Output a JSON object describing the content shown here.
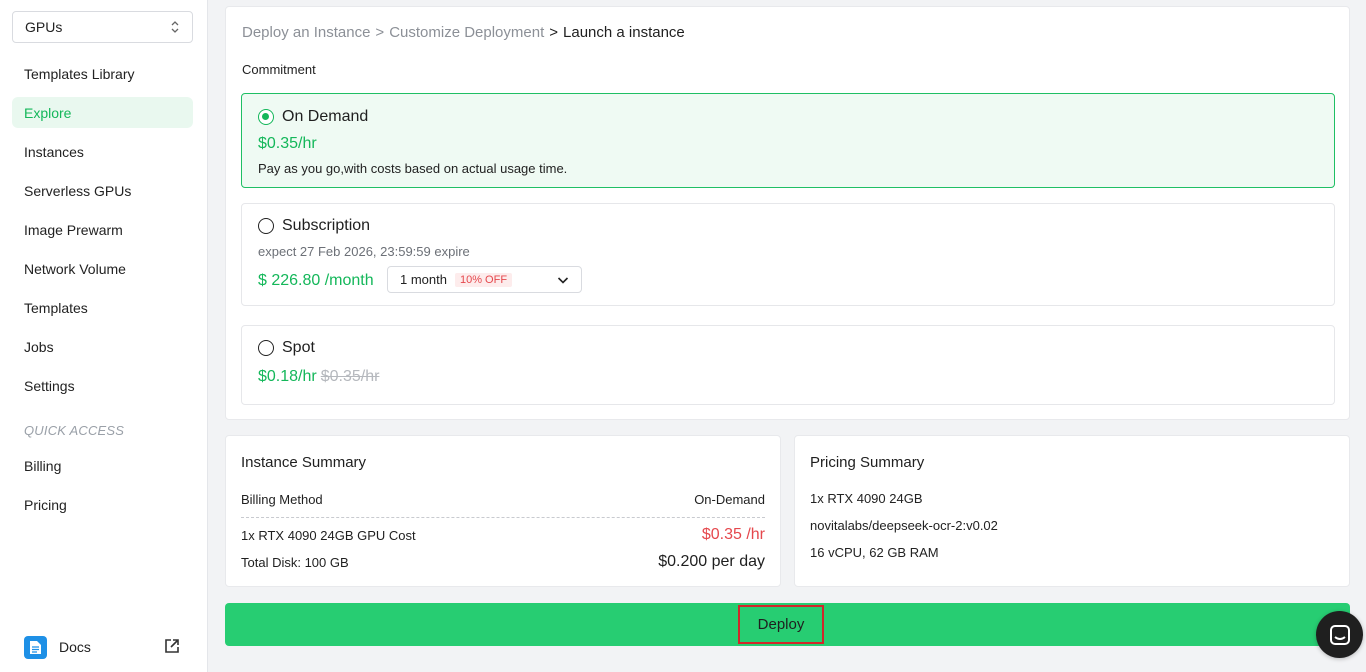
{
  "sidebar": {
    "gpu_select_value": "GPUs",
    "items": [
      {
        "label": "Templates Library"
      },
      {
        "label": "Explore",
        "active": true
      },
      {
        "label": "Instances"
      },
      {
        "label": "Serverless GPUs"
      },
      {
        "label": "Image Prewarm"
      },
      {
        "label": "Network Volume"
      },
      {
        "label": "Templates"
      },
      {
        "label": "Jobs"
      },
      {
        "label": "Settings"
      }
    ],
    "quick_access_label": "QUICK ACCESS",
    "quick_items": [
      {
        "label": "Billing"
      },
      {
        "label": "Pricing"
      }
    ],
    "docs_label": "Docs"
  },
  "breadcrumb": {
    "step1": "Deploy an Instance",
    "step2": "Customize Deployment",
    "step3": "Launch a instance",
    "separator": ">"
  },
  "commitment": {
    "label": "Commitment",
    "on_demand": {
      "title": "On Demand",
      "price": "$0.35/hr",
      "description": "Pay as you go,with costs based on actual usage time.",
      "selected": true
    },
    "subscription": {
      "title": "Subscription",
      "expire": "expect  27 Feb 2026, 23:59:59 expire",
      "price": "$ 226.80 /month",
      "period_value": "1 month",
      "discount_badge": "10% OFF"
    },
    "spot": {
      "title": "Spot",
      "price": "$0.18/hr",
      "old_price": "$0.35/hr"
    }
  },
  "instance_summary": {
    "title": "Instance Summary",
    "billing_method_label": "Billing Method",
    "billing_method_value": "On-Demand",
    "gpu_cost_label": "1x RTX 4090 24GB GPU Cost",
    "gpu_cost_value": "$0.35 /hr",
    "disk_label": "Total Disk: 100 GB",
    "per_day_value": "$0.200 per day"
  },
  "pricing_summary": {
    "title": "Pricing Summary",
    "gpu": "1x RTX 4090 24GB",
    "image": "novitalabs/deepseek-ocr-2:v0.02",
    "resources": "16 vCPU, 62 GB RAM"
  },
  "deploy": {
    "label": "Deploy"
  },
  "colors": {
    "accent_green": "#14b75a",
    "deploy_green": "#27cd72",
    "price_red": "#e5484d",
    "highlight_border": "#d2262a"
  }
}
